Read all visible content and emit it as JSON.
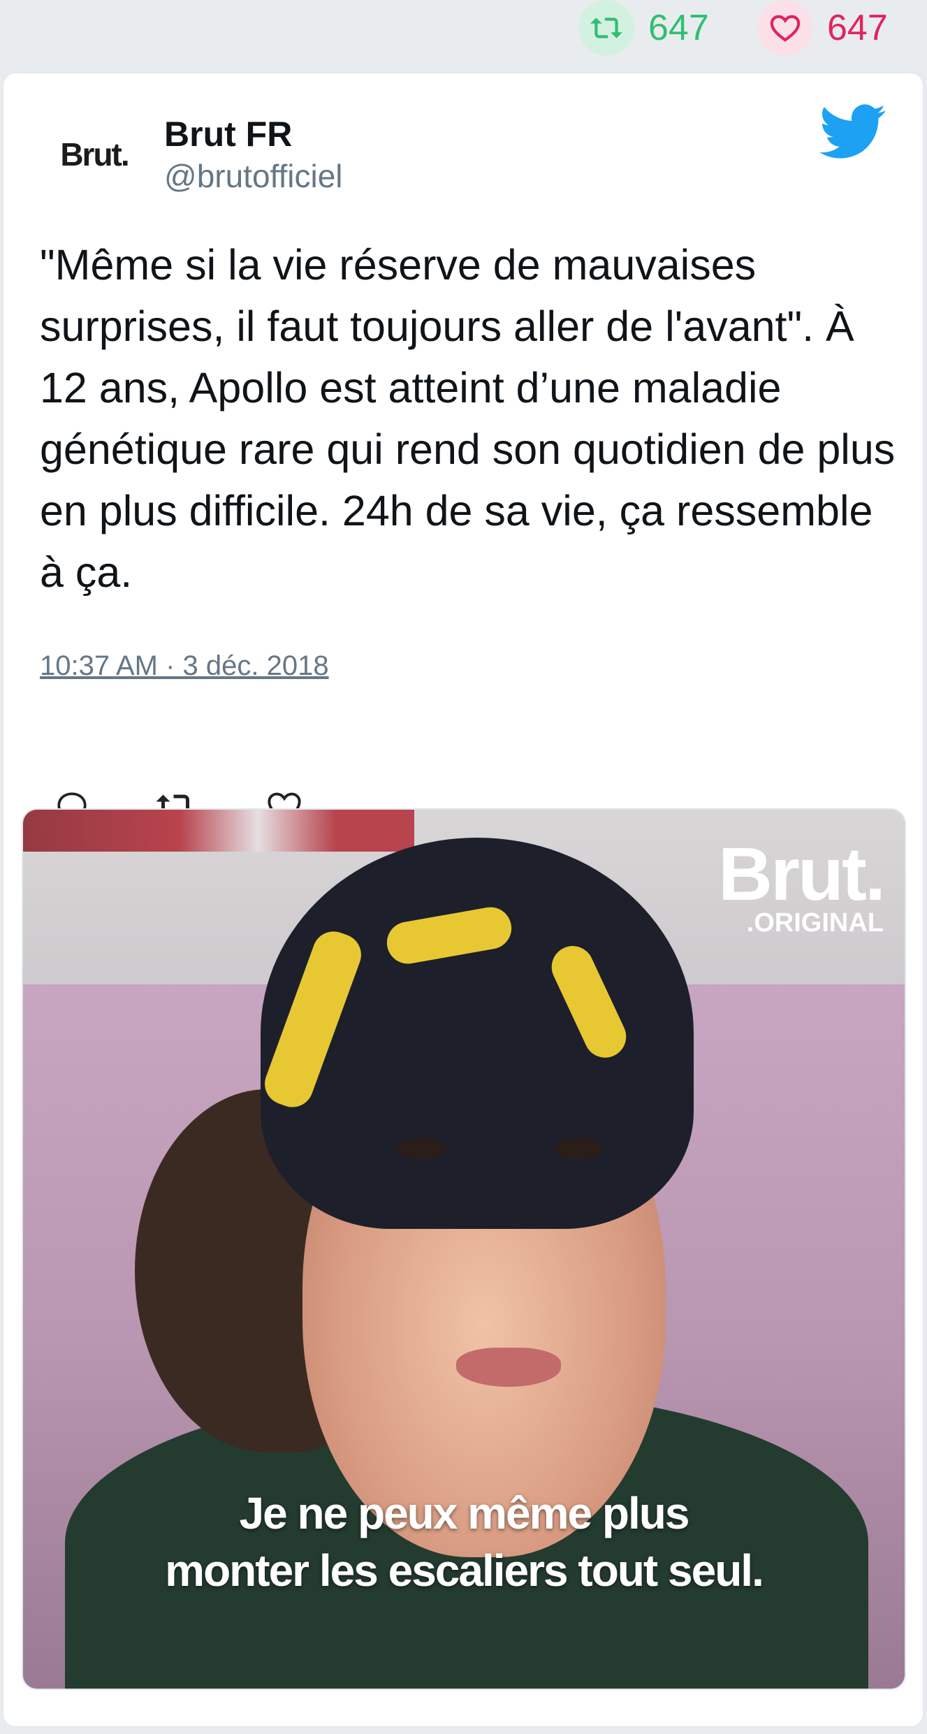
{
  "stats": {
    "retweet_count": "647",
    "like_count": "647",
    "retweet_icon": "retweet-icon",
    "like_icon": "heart-icon"
  },
  "tweet": {
    "author_name": "Brut FR",
    "author_handle": "@brutofficiel",
    "avatar_text": "Brut.",
    "platform_icon": "twitter-bird-icon",
    "text": "\"Même si la vie réserve de mauvaises surprises, il faut toujours aller de l'avant\". À 12 ans, Apollo est atteint d’une maladie génétique rare qui rend son quotidien de plus en plus difficile. 24h de sa vie, ça ressemble à ça.",
    "timestamp": "10:37 AM · 3 déc. 2018",
    "actions": [
      "reply-icon",
      "retweet-icon",
      "like-icon"
    ]
  },
  "media": {
    "logo_main": "Brut.",
    "logo_sub": ".ORIGINAL",
    "subtitle": "Je ne peux même plus\nmonter les escaliers tout seul."
  },
  "colors": {
    "retweet_green": "#2fbf71",
    "like_pink": "#e0245e",
    "twitter_blue": "#1da1f2",
    "text_primary": "#0f1419",
    "text_secondary": "#657786"
  }
}
